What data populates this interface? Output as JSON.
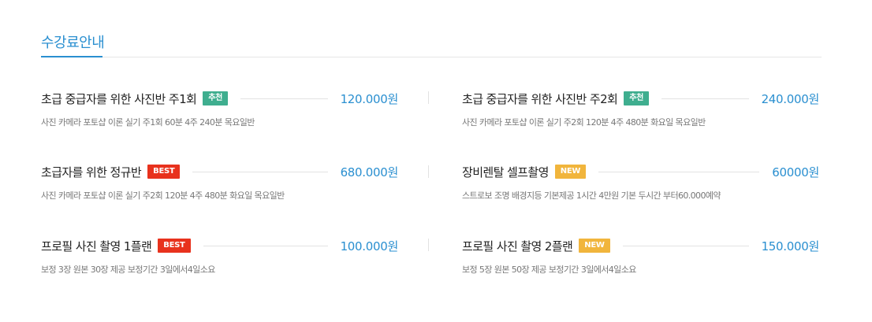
{
  "section": {
    "title": "수강료안내"
  },
  "items": [
    {
      "name": "초급 중급자를 위한 사진반 주1회",
      "badge": "추천",
      "price": "120.000원",
      "desc": "사진 카메라 포토샵 이론 실기 주1회 60분  4주 240분 목요일반"
    },
    {
      "name": "초급 중급자를 위한 사진반 주2회",
      "badge": "추천",
      "price": "240.000원",
      "desc": "사진 카메라 포토샵 이론 실기 주2회 120분  4주 480분 화요일 목요일반"
    },
    {
      "name": "초급자를 위한 정규반",
      "badge": "BEST",
      "price": "680.000원",
      "desc": "사진 카메라 포토샵 이론 실기 주2회 120분  4주 480분 화요일 목요일반"
    },
    {
      "name": "장비렌탈 셀프촬영",
      "badge": "NEW",
      "price": "60000원",
      "desc": "스트로보 조명 배경지등 기본제공  1시간 4만원 기본 두시간 부터60.000예약"
    },
    {
      "name": "프로필 사진 촬영 1플랜",
      "badge": "BEST",
      "price": "100.000원",
      "desc": "보정 3장 원본 30장 제공  보정기간 3일에서4일소요"
    },
    {
      "name": "프로필 사진 촬영 2플랜",
      "badge": "NEW",
      "price": "150.000원",
      "desc": "보정 5장 원본 50장 제공  보정기간 3일에서4일소요"
    }
  ],
  "badge_colors": {
    "recommend": "#3fae8f",
    "best": "#e8321d",
    "new": "#f1b53c"
  },
  "accent_color": "#2a8fd0"
}
